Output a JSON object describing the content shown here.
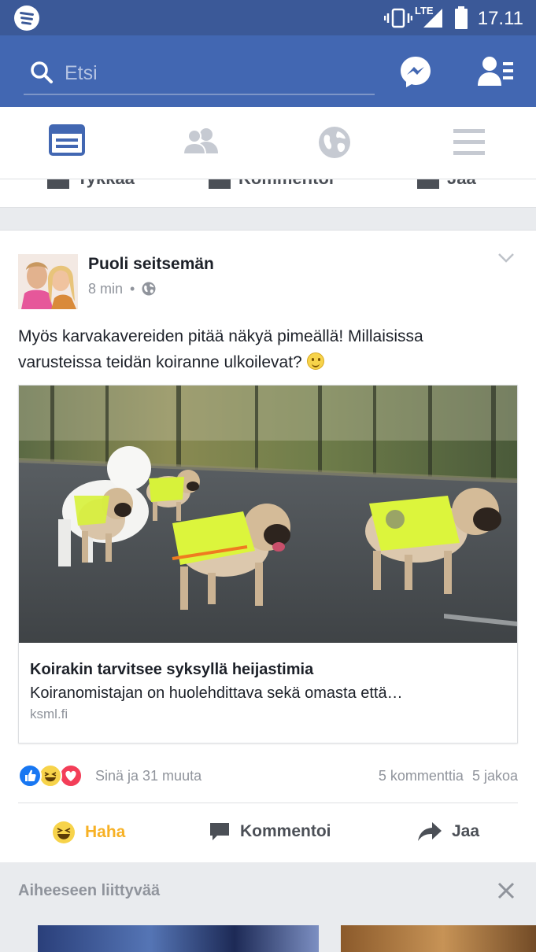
{
  "status": {
    "time": "17.11",
    "network": "LTE"
  },
  "search": {
    "placeholder": "Etsi"
  },
  "nav": {
    "tabs": [
      {
        "id": "news-feed",
        "active": true
      },
      {
        "id": "friends",
        "active": false
      },
      {
        "id": "notifications",
        "active": false
      },
      {
        "id": "menu",
        "active": false
      }
    ]
  },
  "previous_post_actions": {
    "like": "Tykkää",
    "comment": "Kommentoi",
    "share": "Jaa"
  },
  "post": {
    "author": "Puoli seitsemän",
    "time": "8 min",
    "separator": "•",
    "text": "Myös karvakavereiden pitää näkyä pimeällä! Millaisissa varusteissa teidän koiranne ulkoilevat?",
    "link": {
      "title": "Koirakin tarvitsee syksyllä heijastimia",
      "description": "Koiranomistajan on huolehdittava sekä omasta että…",
      "domain": "ksml.fi"
    },
    "reactions": {
      "types": [
        "like",
        "haha",
        "love"
      ],
      "summary": "Sinä ja 31 muuta",
      "comments": "5 kommenttia",
      "shares": "5 jakoa"
    },
    "actions": {
      "reaction": "Haha",
      "comment": "Kommentoi",
      "share": "Jaa"
    }
  },
  "related": {
    "title": "Aiheeseen liittyvää"
  },
  "colors": {
    "brand": "#3b5998",
    "searchbar": "#4267b2",
    "haha": "#f7b125",
    "like": "#1877f2",
    "love": "#f33e58",
    "secondary_text": "#90949c"
  }
}
